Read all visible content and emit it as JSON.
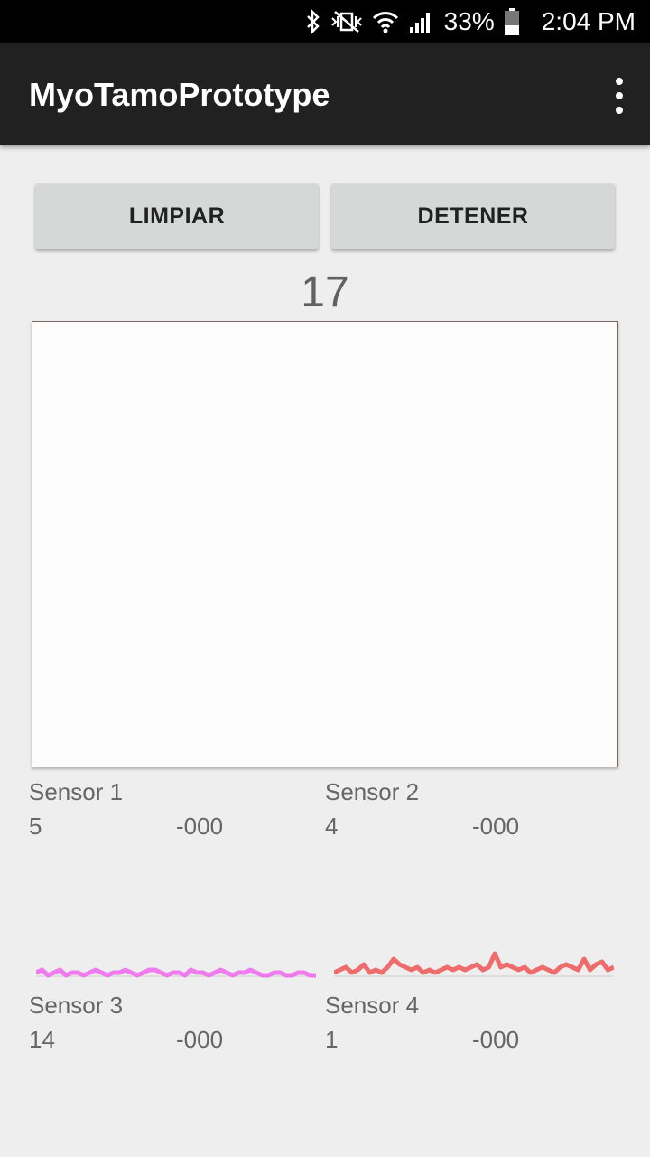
{
  "status_bar": {
    "battery": "33%",
    "time": "2:04 PM",
    "icons": [
      "bluetooth-icon",
      "vibrate-mute-icon",
      "wifi-icon",
      "signal-icon",
      "battery-icon"
    ]
  },
  "app_bar": {
    "title": "MyoTamoPrototype",
    "menu_icon": "more-vert-icon"
  },
  "buttons": {
    "clear": "LIMPIAR",
    "stop": "DETENER"
  },
  "counter": "17",
  "sensors": [
    {
      "name": "Sensor 1",
      "value": "5",
      "reading": "-000"
    },
    {
      "name": "Sensor 2",
      "value": "4",
      "reading": "-000"
    },
    {
      "name": "Sensor 3",
      "value": "14",
      "reading": "-000",
      "color": "#ee66ee"
    },
    {
      "name": "Sensor 4",
      "value": "1",
      "reading": "-000",
      "color": "#ee5555"
    }
  ],
  "chart_data": [
    {
      "type": "line",
      "series": [
        {
          "values": [
            1,
            2,
            0,
            1,
            2,
            0,
            1,
            1,
            0,
            1,
            2,
            1,
            0,
            1,
            1,
            2,
            1,
            0,
            1,
            2,
            2,
            1,
            0,
            1,
            1,
            0,
            2,
            1,
            1,
            0,
            1,
            2,
            1,
            0,
            1,
            1,
            2,
            1,
            0,
            0,
            1,
            1,
            0,
            0,
            1,
            1,
            0,
            0
          ]
        }
      ],
      "color": "#ee66ee"
    },
    {
      "type": "line",
      "series": [
        {
          "values": [
            1,
            2,
            3,
            1,
            2,
            4,
            1,
            2,
            1,
            3,
            6,
            4,
            3,
            2,
            3,
            1,
            2,
            1,
            2,
            3,
            2,
            3,
            2,
            3,
            4,
            2,
            3,
            8,
            3,
            4,
            3,
            2,
            3,
            1,
            2,
            3,
            2,
            1,
            3,
            4,
            3,
            2,
            6,
            2,
            4,
            5,
            2,
            3
          ]
        }
      ],
      "color": "#ee5555"
    }
  ]
}
